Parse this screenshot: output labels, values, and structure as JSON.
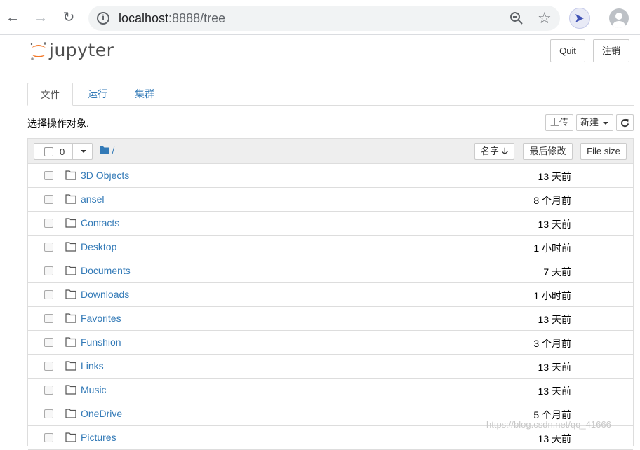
{
  "browser": {
    "url_host": "localhost",
    "url_rest": ":8888/tree"
  },
  "header": {
    "logo_text": "jupyter",
    "quit_label": "Quit",
    "logout_label": "注销"
  },
  "tabs": [
    {
      "label": "文件",
      "active": true
    },
    {
      "label": "运行",
      "active": false
    },
    {
      "label": "集群",
      "active": false
    }
  ],
  "toolbar": {
    "select_label": "选择操作对象.",
    "upload_label": "上传",
    "new_label": "新建"
  },
  "list_header": {
    "selected_count": "0",
    "breadcrumb": "/",
    "sort_name_label": "名字",
    "sort_modified_label": "最后修改",
    "sort_size_label": "File size"
  },
  "files": [
    {
      "name": "3D Objects",
      "modified": "13 天前"
    },
    {
      "name": "ansel",
      "modified": "8 个月前"
    },
    {
      "name": "Contacts",
      "modified": "13 天前"
    },
    {
      "name": "Desktop",
      "modified": "1 小时前"
    },
    {
      "name": "Documents",
      "modified": "7 天前"
    },
    {
      "name": "Downloads",
      "modified": "1 小时前"
    },
    {
      "name": "Favorites",
      "modified": "13 天前"
    },
    {
      "name": "Funshion",
      "modified": "3 个月前"
    },
    {
      "name": "Links",
      "modified": "13 天前"
    },
    {
      "name": "Music",
      "modified": "13 天前"
    },
    {
      "name": "OneDrive",
      "modified": "5 个月前"
    },
    {
      "name": "Pictures",
      "modified": "13 天前"
    }
  ],
  "watermark": "https://blog.csdn.net/qq_41666",
  "colors": {
    "link": "#337ab7",
    "jupyter_orange": "#f37726"
  }
}
